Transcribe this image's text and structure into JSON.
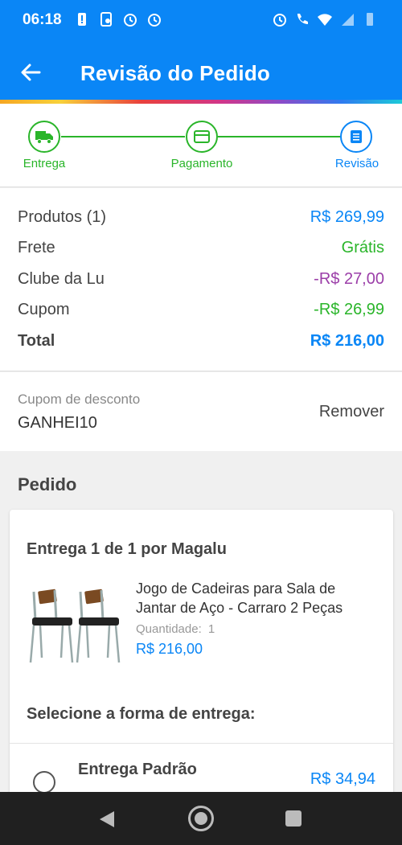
{
  "status_bar": {
    "time": "06:18",
    "network": "4G"
  },
  "app_bar": {
    "title": "Revisão do Pedido",
    "back_icon": "arrow-left-icon"
  },
  "stepper": {
    "steps": [
      {
        "label": "Entrega",
        "icon": "truck-icon",
        "state": "done"
      },
      {
        "label": "Pagamento",
        "icon": "credit-card-icon",
        "state": "done"
      },
      {
        "label": "Revisão",
        "icon": "list-icon",
        "state": "current"
      }
    ]
  },
  "summary": {
    "rows": [
      {
        "label": "Produtos (1)",
        "value": "R$ 269,99",
        "color": "#0a86f6"
      },
      {
        "label": "Frete",
        "value": "Grátis",
        "color": "#2ab52a"
      },
      {
        "label": "Clube da Lu",
        "value": "-R$ 27,00",
        "color": "#9b3ea8"
      },
      {
        "label": "Cupom",
        "value": "-R$ 26,99",
        "color": "#2ab52a"
      }
    ],
    "total": {
      "label": "Total",
      "value": "R$ 216,00",
      "color": "#0a86f6"
    }
  },
  "coupon": {
    "label": "Cupom de desconto",
    "code": "GANHEI10",
    "remove_label": "Remover"
  },
  "order": {
    "heading": "Pedido",
    "shipment_title": "Entrega 1 de 1 por Magalu",
    "product": {
      "name": "Jogo de Cadeiras para Sala de Jantar de Aço - Carraro 2 Peças",
      "quantity_label": "Quantidade:",
      "quantity": "1",
      "price": "R$ 216,00"
    },
    "delivery_heading": "Selecione a forma de entrega:",
    "delivery_option": {
      "name": "Entrega Padrão",
      "price": "R$ 34,94"
    }
  },
  "colors": {
    "primary": "#0a86f6",
    "success": "#2ab52a",
    "club": "#9b3ea8"
  }
}
